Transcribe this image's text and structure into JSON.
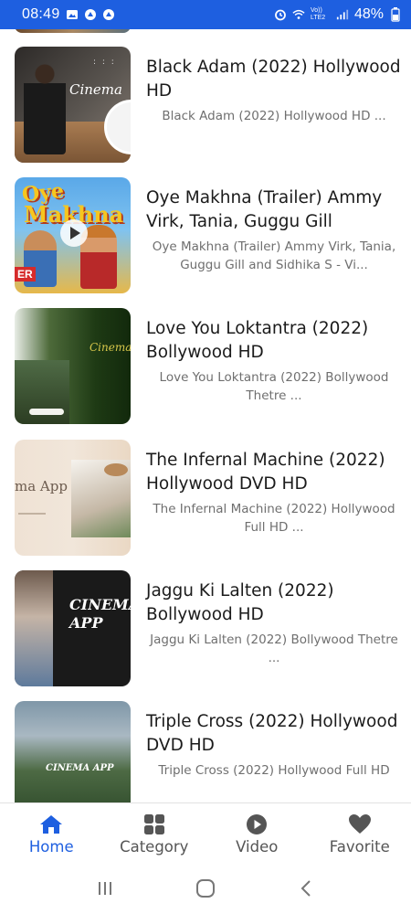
{
  "status_bar": {
    "time": "08:49",
    "network_label": "Vo)) LTE2",
    "battery": "48%"
  },
  "items": [
    {
      "title": "Black Adam (2022) Hollywood HD",
      "subtitle": "Black Adam (2022) Hollywood HD ...",
      "thumb_text": "Cinema"
    },
    {
      "title": "Oye Makhna (Trailer) Ammy Virk, Tania, Guggu Gill",
      "subtitle": "Oye Makhna (Trailer) Ammy Virk, Tania, Guggu Gill and Sidhika S - Vi...",
      "thumb_text": "Oye Makhna"
    },
    {
      "title": "Love You Loktantra (2022) Bollywood HD",
      "subtitle": "Love You Loktantra (2022) Bollywood Thetre ...",
      "thumb_text": "Cinema"
    },
    {
      "title": "The Infernal Machine (2022) Hollywood DVD HD",
      "subtitle": "The Infernal Machine (2022) Hollywood Full HD ...",
      "thumb_text": "ma App"
    },
    {
      "title": "Jaggu Ki Lalten (2022) Bollywood HD",
      "subtitle": "Jaggu Ki Lalten (2022) Bollywood Thetre ...",
      "thumb_text": "CINEMA APP"
    },
    {
      "title": "Triple Cross (2022) Hollywood DVD HD",
      "subtitle": "Triple Cross (2022) Hollywood Full HD",
      "thumb_text": "CINEMA APP"
    }
  ],
  "bottom_nav": {
    "home": "Home",
    "category": "Category",
    "video": "Video",
    "favorite": "Favorite",
    "active": "home"
  },
  "colors": {
    "accent": "#1e5fe0",
    "text": "#1b1b1b",
    "subtext": "#6f6f6f",
    "inactive_icon": "#555555"
  },
  "icons": {
    "home": "home-icon",
    "category": "grid-icon",
    "video": "play-circle-icon",
    "favorite": "heart-icon"
  }
}
